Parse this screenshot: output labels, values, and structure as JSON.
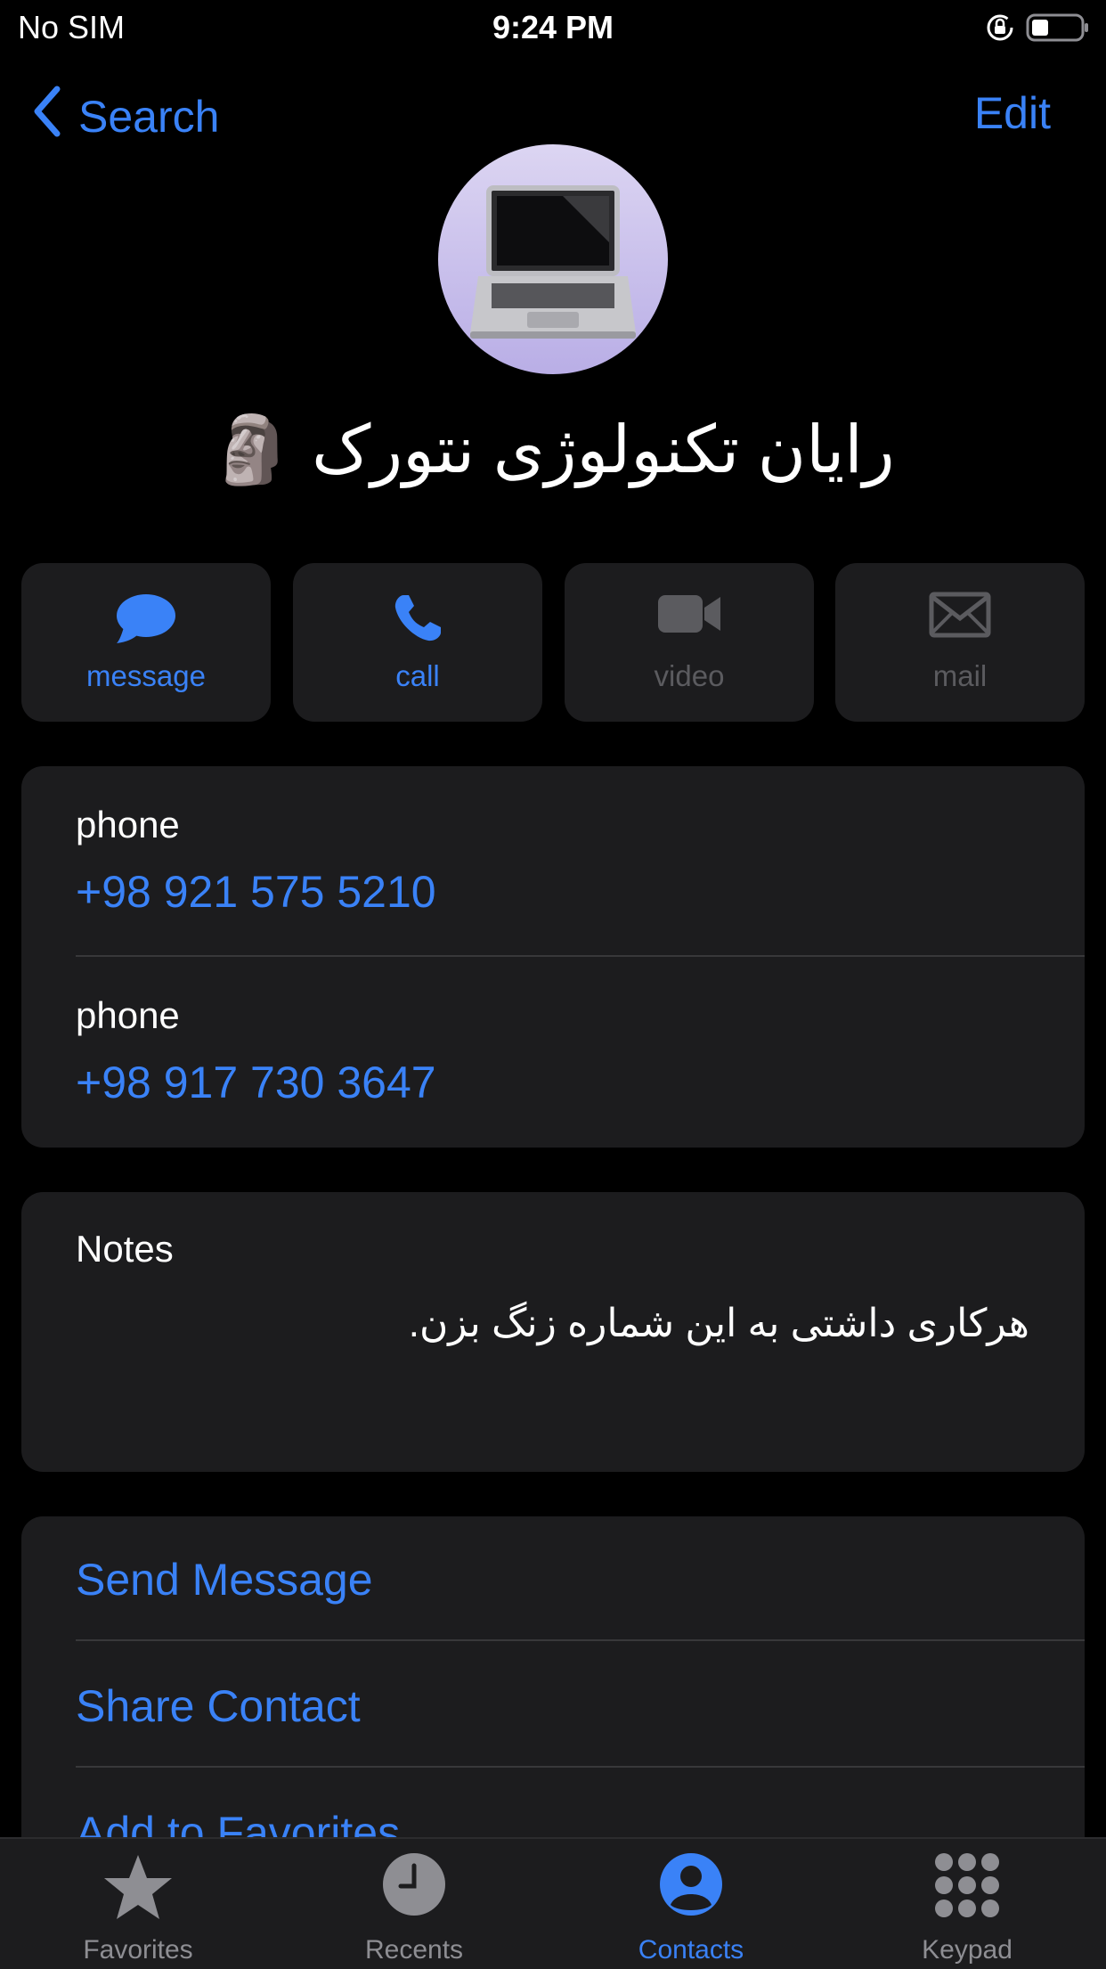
{
  "status": {
    "carrier": "No SIM",
    "time": "9:24 PM"
  },
  "nav": {
    "back_label": "Search",
    "edit_label": "Edit"
  },
  "contact": {
    "name": "رایان تکنولوژی نتورک 🗿"
  },
  "actions": [
    {
      "label": "message",
      "icon": "message-bubble-icon",
      "enabled": true
    },
    {
      "label": "call",
      "icon": "phone-icon",
      "enabled": true
    },
    {
      "label": "video",
      "icon": "video-camera-icon",
      "enabled": false
    },
    {
      "label": "mail",
      "icon": "mail-envelope-icon",
      "enabled": false
    }
  ],
  "phones": [
    {
      "label": "phone",
      "value": "+98 921 575 5210"
    },
    {
      "label": "phone",
      "value": "+98 917 730 3647"
    }
  ],
  "notes": {
    "label": "Notes",
    "text": "هرکاری داشتی به این شماره زنگ بزن."
  },
  "links": [
    {
      "label": "Send Message"
    },
    {
      "label": "Share Contact"
    },
    {
      "label": "Add to Favorites"
    }
  ],
  "tabs": [
    {
      "label": "Favorites",
      "icon": "star-icon",
      "active": false
    },
    {
      "label": "Recents",
      "icon": "clock-icon",
      "active": false
    },
    {
      "label": "Contacts",
      "icon": "person-circle-icon",
      "active": true
    },
    {
      "label": "Keypad",
      "icon": "keypad-icon",
      "active": false
    }
  ],
  "colors": {
    "accent": "#3a82f7",
    "background": "#000000",
    "card": "#1c1c1e",
    "disabled": "#5b5b5f"
  }
}
